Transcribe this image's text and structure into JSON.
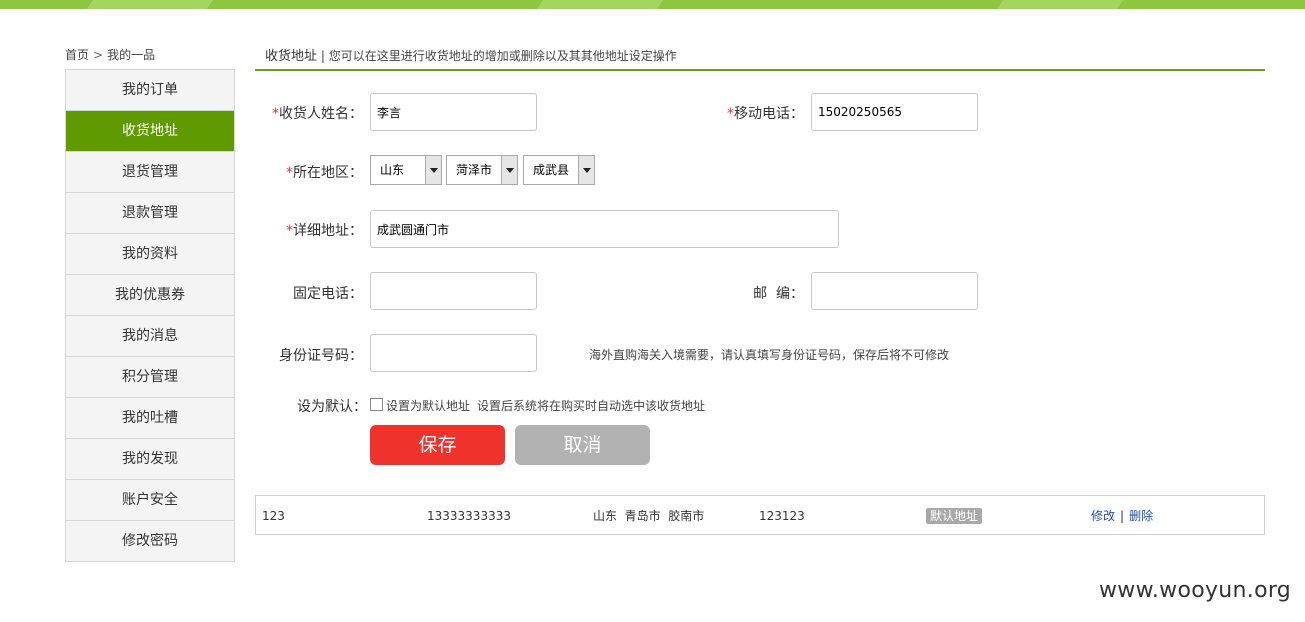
{
  "breadcrumb": {
    "home": "首页",
    "separator": ">",
    "current": "我的一品"
  },
  "sidebar": {
    "items": [
      {
        "label": "我的订单"
      },
      {
        "label": "收货地址"
      },
      {
        "label": "退货管理"
      },
      {
        "label": "退款管理"
      },
      {
        "label": "我的资料"
      },
      {
        "label": "我的优惠券"
      },
      {
        "label": "我的消息"
      },
      {
        "label": "积分管理"
      },
      {
        "label": "我的吐槽"
      },
      {
        "label": "我的发现"
      },
      {
        "label": "账户安全"
      },
      {
        "label": "修改密码"
      }
    ],
    "active_index": 1
  },
  "header": {
    "title": "收货地址",
    "divider": " | ",
    "description": "您可以在这里进行收货地址的增加或删除以及其其他地址设定操作"
  },
  "form": {
    "required_mark": "*",
    "name": {
      "label": "收货人姓名：",
      "value": "李言"
    },
    "mobile": {
      "label": "移动电话：",
      "value": "15020250565"
    },
    "region": {
      "label": "所在地区：",
      "province": "山东",
      "city": "菏泽市",
      "county": "成武县"
    },
    "address": {
      "label": "详细地址：",
      "value": "成武圆通门市"
    },
    "phone": {
      "label": "固定电话：",
      "value": ""
    },
    "zip": {
      "label": "邮  编：",
      "value": ""
    },
    "id_card": {
      "label": "身份证号码：",
      "value": "",
      "hint": "海外直购海关入境需要，请认真填写身份证号码，保存后将不可修改"
    },
    "default": {
      "label": "设为默认：",
      "checkbox_label": "设置为默认地址",
      "hint": "设置后系统将在购买时自动选中该收货地址",
      "checked": false
    },
    "save_label": "保存",
    "cancel_label": "取消"
  },
  "address_list": [
    {
      "name": "123",
      "phone": "13333333333",
      "region": "山东  青岛市  胶南市",
      "zip": "123123",
      "badge": "默认地址",
      "edit_label": "修改",
      "separator": "|",
      "delete_label": "删除"
    }
  ],
  "watermark": "www.wooyun.org",
  "colors": {
    "brand_green": "#5f9a00",
    "top_bar": "#8dc63f",
    "save_red": "#f0322d",
    "cancel_gray": "#b2b2b2",
    "link_blue": "#1e4fa2"
  }
}
